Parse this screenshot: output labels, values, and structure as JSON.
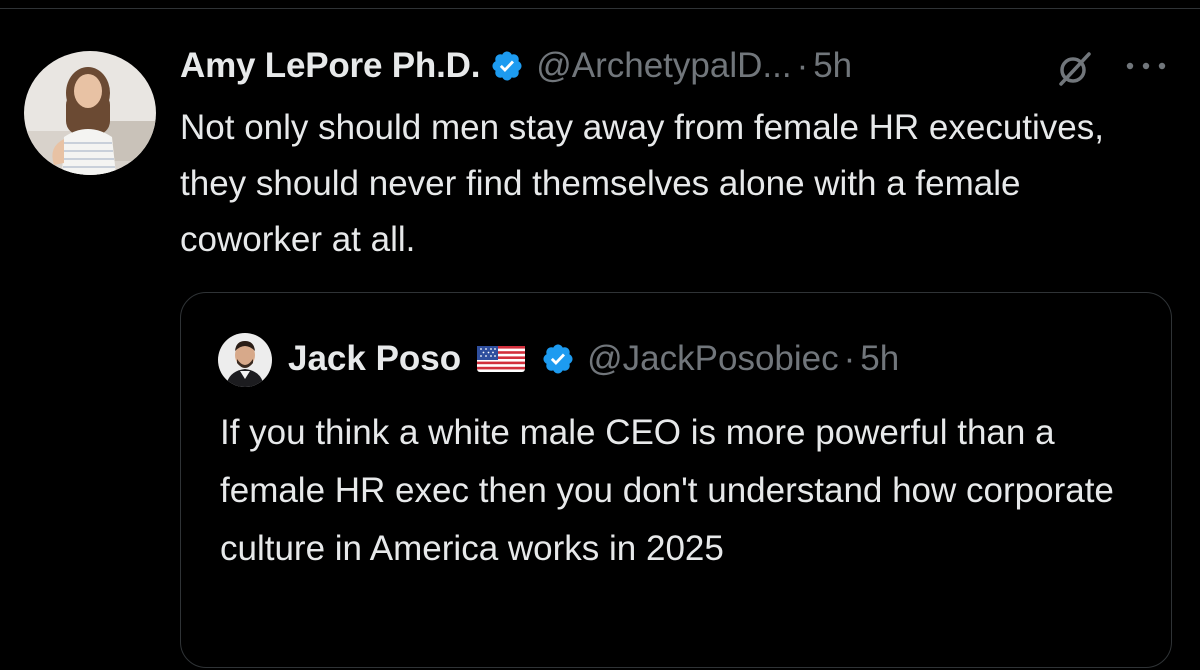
{
  "tweet": {
    "author": {
      "display_name": "Amy LePore Ph.D.",
      "handle": "@ArchetypalD...",
      "verified": true,
      "avatar_icon": "user-avatar-photo"
    },
    "separator": "·",
    "time": "5h",
    "text": "Not only should men stay away from female HR executives, they should never find themselves alone with a female coworker at all.",
    "actions": {
      "grok_icon": "grok-icon",
      "more_icon": "more-options-icon"
    }
  },
  "quoted_tweet": {
    "author": {
      "display_name": "Jack Poso",
      "flag_icon": "us-flag-icon",
      "handle": "@JackPosobiec",
      "verified": true,
      "avatar_icon": "user-avatar-photo"
    },
    "separator": "·",
    "time": "5h",
    "text": "If you think a white male CEO is more powerful than a female HR exec then you don't understand how corporate culture in America works in 2025"
  },
  "colors": {
    "background": "#000000",
    "text_primary": "#e7e9ea",
    "text_secondary": "#71767b",
    "verified_blue": "#1d9bf0",
    "border": "#2f3336"
  }
}
